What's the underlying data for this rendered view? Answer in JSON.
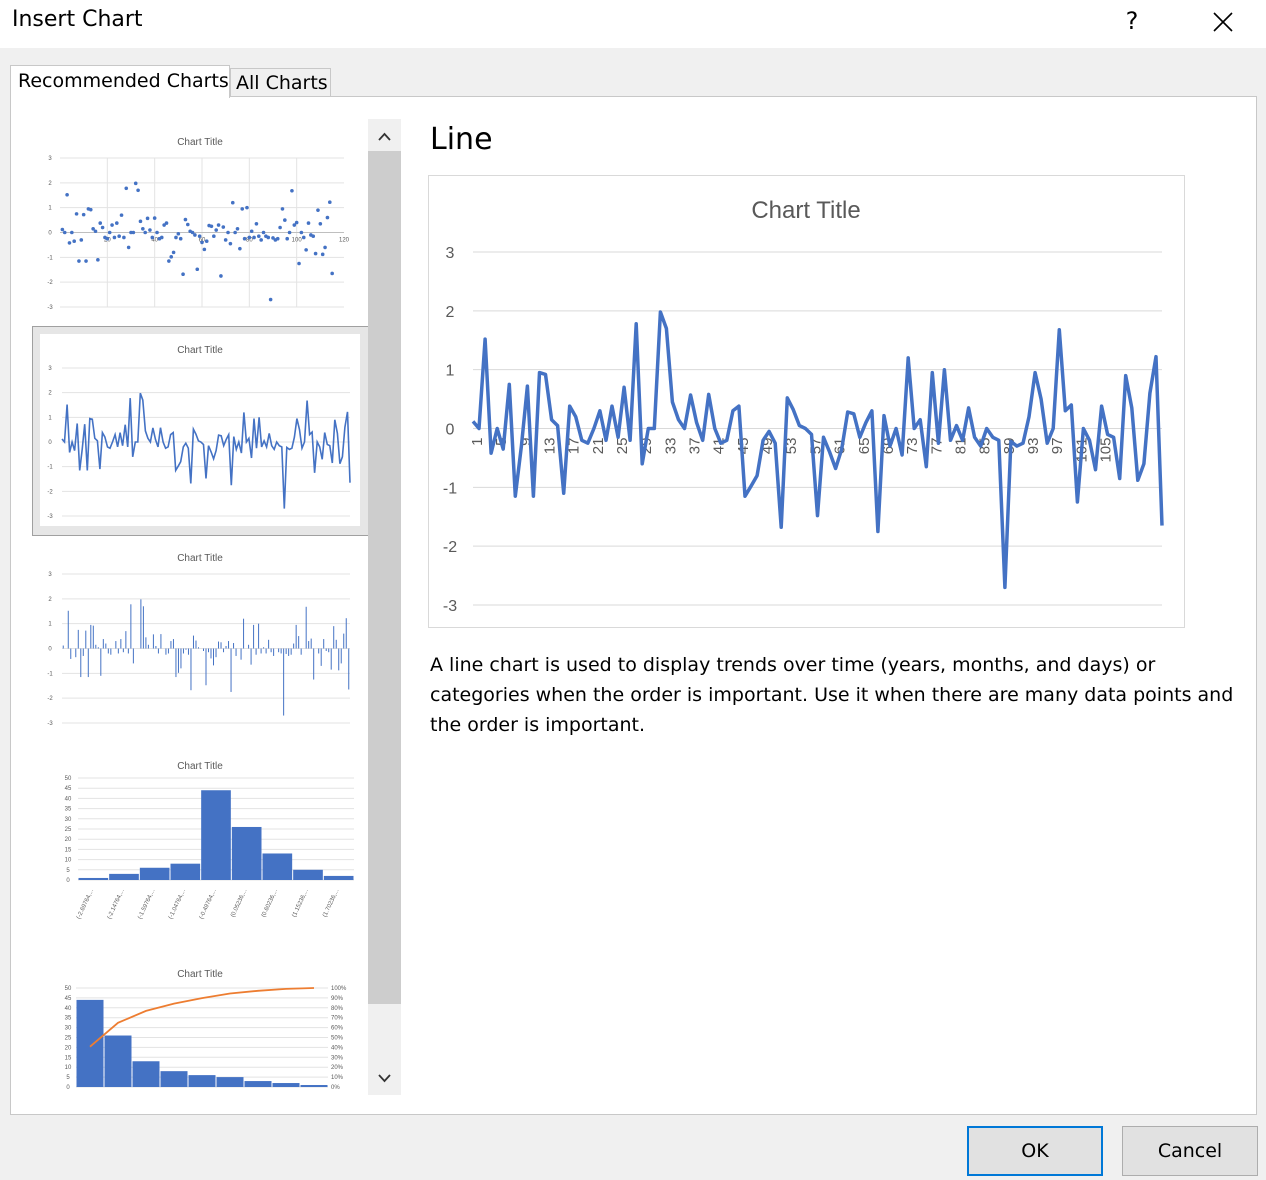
{
  "dialog": {
    "title": "Insert Chart",
    "help_label": "?",
    "close_icon": "close-icon"
  },
  "tabs": [
    {
      "label": "Recommended Charts",
      "selected": true
    },
    {
      "label": "All Charts",
      "selected": false
    }
  ],
  "thumbnails": [
    {
      "type": "scatter",
      "title": "Chart Title",
      "x_ticks": [
        "0",
        "20",
        "40",
        "60",
        "80",
        "100",
        "120"
      ],
      "y_ticks": [
        "3",
        "2",
        "1",
        "0",
        "-1",
        "-2",
        "-3"
      ]
    },
    {
      "type": "line",
      "title": "Chart Title",
      "selected": true,
      "y_ticks": [
        "3",
        "2",
        "1",
        "0",
        "-1",
        "-2",
        "-3"
      ]
    },
    {
      "type": "clustered-column",
      "title": "Chart Title",
      "y_ticks": [
        "3",
        "2",
        "1",
        "0",
        "-1",
        "-2",
        "-3"
      ]
    },
    {
      "type": "histogram",
      "title": "Chart Title",
      "y_ticks": [
        "50",
        "45",
        "40",
        "35",
        "30",
        "25",
        "20",
        "15",
        "10",
        "5",
        "0"
      ],
      "bins": [
        "(-2.69764,...",
        "(-2.14764,...",
        "(-1.59764,...",
        "(-1.04764,...",
        "(-0.49764,...",
        "(0.05236,...",
        "(0.60236,...",
        "(1.15236,...",
        "(1.70236,..."
      ],
      "values": [
        1,
        3,
        6,
        8,
        44,
        26,
        13,
        5,
        2
      ]
    },
    {
      "type": "pareto",
      "title": "Chart Title",
      "y_ticks": [
        "50",
        "45",
        "40",
        "35",
        "30",
        "25",
        "20",
        "15",
        "10",
        "5",
        "0"
      ],
      "y2_ticks": [
        "100%",
        "90%",
        "80%",
        "70%",
        "60%",
        "50%",
        "40%",
        "30%",
        "20%",
        "10%",
        "0%"
      ],
      "values": [
        44,
        26,
        13,
        8,
        6,
        5,
        3,
        2,
        1
      ]
    }
  ],
  "scroll": {
    "up_icon": "chevron-up-icon",
    "down_icon": "chevron-down-icon"
  },
  "preview": {
    "heading": "Line",
    "description": "A line chart is used to display trends over time (years, months, and days) or categories when the order is important. Use it when there are many data points and the order is important."
  },
  "chart_data": {
    "type": "line",
    "title": "Chart Title",
    "xlabel": "",
    "ylabel": "",
    "ylim": [
      -3,
      3
    ],
    "y_ticks": [
      "3",
      "2",
      "1",
      "0",
      "-1",
      "-2",
      "-3"
    ],
    "x_tick_labels": [
      "1",
      "5",
      "9",
      "13",
      "17",
      "21",
      "25",
      "29",
      "33",
      "37",
      "41",
      "45",
      "49",
      "53",
      "57",
      "61",
      "65",
      "69",
      "73",
      "77",
      "81",
      "85",
      "89",
      "93",
      "97",
      "101",
      "105"
    ],
    "grid": true,
    "legend": "none",
    "series_color": "#4472c4",
    "values": [
      0.12,
      0.0,
      1.52,
      -0.42,
      0.0,
      -0.35,
      0.75,
      -1.15,
      -0.3,
      0.72,
      -1.15,
      0.95,
      0.92,
      0.15,
      0.05,
      -1.1,
      0.38,
      0.2,
      -0.2,
      -0.25,
      0.0,
      0.3,
      -0.2,
      0.38,
      -0.15,
      0.7,
      -0.2,
      1.78,
      -0.6,
      0.0,
      0.0,
      1.98,
      1.7,
      0.45,
      0.15,
      0.0,
      0.57,
      0.1,
      -0.2,
      0.58,
      0.0,
      -0.25,
      -0.2,
      0.3,
      0.38,
      -1.15,
      -0.98,
      -0.8,
      -0.2,
      -0.05,
      -0.25,
      -1.68,
      0.52,
      0.32,
      0.05,
      0.0,
      -0.1,
      -1.48,
      -0.15,
      -0.4,
      -0.68,
      -0.35,
      0.28,
      0.25,
      -0.15,
      0.1,
      0.3,
      -1.75,
      0.22,
      -0.3,
      0.0,
      -0.45,
      1.2,
      0.0,
      0.15,
      -0.65,
      0.95,
      -0.25,
      1.0,
      -0.2,
      0.05,
      -0.2,
      0.35,
      -0.15,
      -0.3,
      0.0,
      -0.15,
      -0.2,
      -2.7,
      -0.22,
      -0.3,
      -0.25,
      0.2,
      0.95,
      0.5,
      -0.25,
      0.0,
      1.68,
      0.3,
      0.4,
      -1.25,
      0.0,
      -0.2,
      -0.7,
      0.38,
      -0.1,
      -0.15,
      -0.85,
      0.9,
      0.35,
      -0.88,
      -0.6,
      0.6,
      1.22,
      -1.65
    ]
  },
  "buttons": {
    "ok": "OK",
    "cancel": "Cancel"
  },
  "colors": {
    "accent": "#0078d7",
    "series": "#4472c4",
    "pareto_line": "#ed7d31"
  }
}
